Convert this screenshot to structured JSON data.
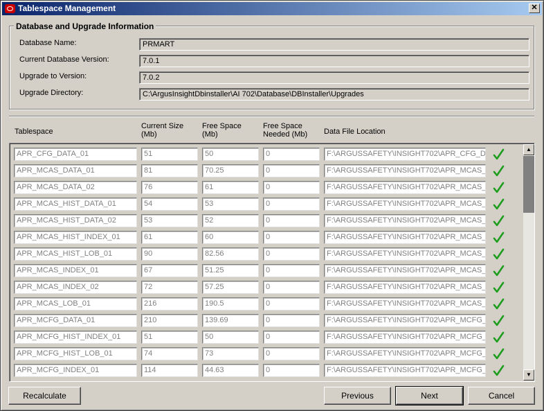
{
  "window": {
    "title": "Tablespace Management",
    "close_glyph": "✕"
  },
  "info": {
    "group_title": "Database and Upgrade Information",
    "fields": [
      {
        "label": "Database Name:",
        "value": "PRMART"
      },
      {
        "label": "Current Database Version:",
        "value": "7.0.1"
      },
      {
        "label": "Upgrade to Version:",
        "value": "7.0.2"
      },
      {
        "label": "Upgrade Directory:",
        "value": "C:\\ArgusInsightDbinstaller\\AI 702\\Database\\DBInstaller\\Upgrades"
      }
    ]
  },
  "columns": {
    "tablespace": "Tablespace",
    "current_size_1": "Current Size",
    "current_size_2": "(Mb)",
    "free_space_1": "Free Space",
    "free_space_2": "(Mb)",
    "needed_1": "Free Space",
    "needed_2": "Needed (Mb)",
    "location": "Data File Location"
  },
  "rows": [
    {
      "name": "APR_CFG_DATA_01",
      "size": "51",
      "free": "50",
      "needed": "0",
      "location": "F:\\ARGUSSAFETY\\INSIGHT702\\APR_CFG_D"
    },
    {
      "name": "APR_MCAS_DATA_01",
      "size": "81",
      "free": "70.25",
      "needed": "0",
      "location": "F:\\ARGUSSAFETY\\INSIGHT702\\APR_MCAS_"
    },
    {
      "name": "APR_MCAS_DATA_02",
      "size": "76",
      "free": "61",
      "needed": "0",
      "location": "F:\\ARGUSSAFETY\\INSIGHT702\\APR_MCAS_"
    },
    {
      "name": "APR_MCAS_HIST_DATA_01",
      "size": "54",
      "free": "53",
      "needed": "0",
      "location": "F:\\ARGUSSAFETY\\INSIGHT702\\APR_MCAS_"
    },
    {
      "name": "APR_MCAS_HIST_DATA_02",
      "size": "53",
      "free": "52",
      "needed": "0",
      "location": "F:\\ARGUSSAFETY\\INSIGHT702\\APR_MCAS_"
    },
    {
      "name": "APR_MCAS_HIST_INDEX_01",
      "size": "61",
      "free": "60",
      "needed": "0",
      "location": "F:\\ARGUSSAFETY\\INSIGHT702\\APR_MCAS_"
    },
    {
      "name": "APR_MCAS_HIST_LOB_01",
      "size": "90",
      "free": "82.56",
      "needed": "0",
      "location": "F:\\ARGUSSAFETY\\INSIGHT702\\APR_MCAS_"
    },
    {
      "name": "APR_MCAS_INDEX_01",
      "size": "67",
      "free": "51.25",
      "needed": "0",
      "location": "F:\\ARGUSSAFETY\\INSIGHT702\\APR_MCAS_"
    },
    {
      "name": "APR_MCAS_INDEX_02",
      "size": "72",
      "free": "57.25",
      "needed": "0",
      "location": "F:\\ARGUSSAFETY\\INSIGHT702\\APR_MCAS_"
    },
    {
      "name": "APR_MCAS_LOB_01",
      "size": "216",
      "free": "190.5",
      "needed": "0",
      "location": "F:\\ARGUSSAFETY\\INSIGHT702\\APR_MCAS_"
    },
    {
      "name": "APR_MCFG_DATA_01",
      "size": "210",
      "free": "139.69",
      "needed": "0",
      "location": "F:\\ARGUSSAFETY\\INSIGHT702\\APR_MCFG_"
    },
    {
      "name": "APR_MCFG_HIST_INDEX_01",
      "size": "51",
      "free": "50",
      "needed": "0",
      "location": "F:\\ARGUSSAFETY\\INSIGHT702\\APR_MCFG_"
    },
    {
      "name": "APR_MCFG_HIST_LOB_01",
      "size": "74",
      "free": "73",
      "needed": "0",
      "location": "F:\\ARGUSSAFETY\\INSIGHT702\\APR_MCFG_"
    },
    {
      "name": "APR_MCFG_INDEX_01",
      "size": "114",
      "free": "44.63",
      "needed": "0",
      "location": "F:\\ARGUSSAFETY\\INSIGHT702\\APR_MCFG_"
    }
  ],
  "row_icon": "checkmark-icon",
  "colors": {
    "check": "#1e9e1e",
    "titlebar": "#0a246a",
    "face": "#d4d0c8"
  },
  "buttons": {
    "recalculate": "Recalculate",
    "previous": "Previous",
    "next": "Next",
    "cancel": "Cancel"
  },
  "scrollbar": {
    "up_glyph": "▲",
    "down_glyph": "▼"
  }
}
